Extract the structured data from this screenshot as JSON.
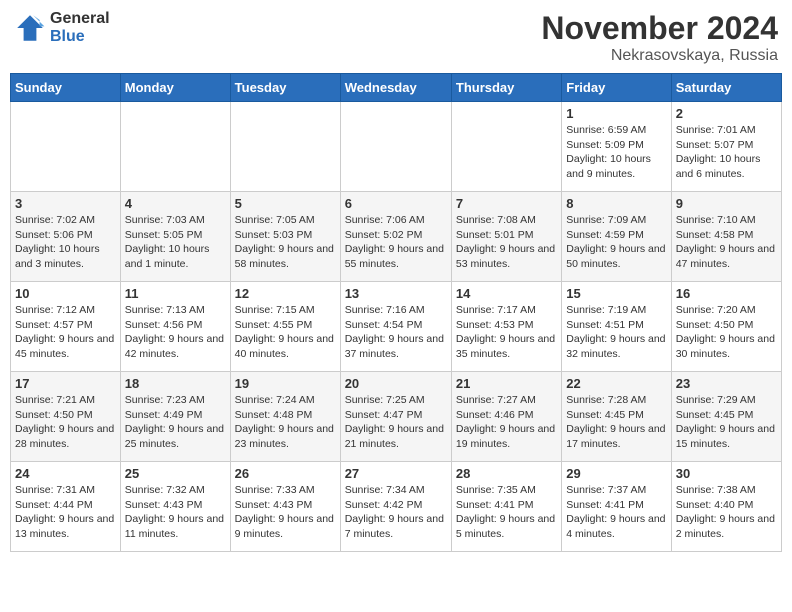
{
  "logo": {
    "general": "General",
    "blue": "Blue"
  },
  "header": {
    "month": "November 2024",
    "location": "Nekrasovskaya, Russia"
  },
  "weekdays": [
    "Sunday",
    "Monday",
    "Tuesday",
    "Wednesday",
    "Thursday",
    "Friday",
    "Saturday"
  ],
  "weeks": [
    [
      {
        "day": "",
        "info": ""
      },
      {
        "day": "",
        "info": ""
      },
      {
        "day": "",
        "info": ""
      },
      {
        "day": "",
        "info": ""
      },
      {
        "day": "",
        "info": ""
      },
      {
        "day": "1",
        "info": "Sunrise: 6:59 AM\nSunset: 5:09 PM\nDaylight: 10 hours and 9 minutes."
      },
      {
        "day": "2",
        "info": "Sunrise: 7:01 AM\nSunset: 5:07 PM\nDaylight: 10 hours and 6 minutes."
      }
    ],
    [
      {
        "day": "3",
        "info": "Sunrise: 7:02 AM\nSunset: 5:06 PM\nDaylight: 10 hours and 3 minutes."
      },
      {
        "day": "4",
        "info": "Sunrise: 7:03 AM\nSunset: 5:05 PM\nDaylight: 10 hours and 1 minute."
      },
      {
        "day": "5",
        "info": "Sunrise: 7:05 AM\nSunset: 5:03 PM\nDaylight: 9 hours and 58 minutes."
      },
      {
        "day": "6",
        "info": "Sunrise: 7:06 AM\nSunset: 5:02 PM\nDaylight: 9 hours and 55 minutes."
      },
      {
        "day": "7",
        "info": "Sunrise: 7:08 AM\nSunset: 5:01 PM\nDaylight: 9 hours and 53 minutes."
      },
      {
        "day": "8",
        "info": "Sunrise: 7:09 AM\nSunset: 4:59 PM\nDaylight: 9 hours and 50 minutes."
      },
      {
        "day": "9",
        "info": "Sunrise: 7:10 AM\nSunset: 4:58 PM\nDaylight: 9 hours and 47 minutes."
      }
    ],
    [
      {
        "day": "10",
        "info": "Sunrise: 7:12 AM\nSunset: 4:57 PM\nDaylight: 9 hours and 45 minutes."
      },
      {
        "day": "11",
        "info": "Sunrise: 7:13 AM\nSunset: 4:56 PM\nDaylight: 9 hours and 42 minutes."
      },
      {
        "day": "12",
        "info": "Sunrise: 7:15 AM\nSunset: 4:55 PM\nDaylight: 9 hours and 40 minutes."
      },
      {
        "day": "13",
        "info": "Sunrise: 7:16 AM\nSunset: 4:54 PM\nDaylight: 9 hours and 37 minutes."
      },
      {
        "day": "14",
        "info": "Sunrise: 7:17 AM\nSunset: 4:53 PM\nDaylight: 9 hours and 35 minutes."
      },
      {
        "day": "15",
        "info": "Sunrise: 7:19 AM\nSunset: 4:51 PM\nDaylight: 9 hours and 32 minutes."
      },
      {
        "day": "16",
        "info": "Sunrise: 7:20 AM\nSunset: 4:50 PM\nDaylight: 9 hours and 30 minutes."
      }
    ],
    [
      {
        "day": "17",
        "info": "Sunrise: 7:21 AM\nSunset: 4:50 PM\nDaylight: 9 hours and 28 minutes."
      },
      {
        "day": "18",
        "info": "Sunrise: 7:23 AM\nSunset: 4:49 PM\nDaylight: 9 hours and 25 minutes."
      },
      {
        "day": "19",
        "info": "Sunrise: 7:24 AM\nSunset: 4:48 PM\nDaylight: 9 hours and 23 minutes."
      },
      {
        "day": "20",
        "info": "Sunrise: 7:25 AM\nSunset: 4:47 PM\nDaylight: 9 hours and 21 minutes."
      },
      {
        "day": "21",
        "info": "Sunrise: 7:27 AM\nSunset: 4:46 PM\nDaylight: 9 hours and 19 minutes."
      },
      {
        "day": "22",
        "info": "Sunrise: 7:28 AM\nSunset: 4:45 PM\nDaylight: 9 hours and 17 minutes."
      },
      {
        "day": "23",
        "info": "Sunrise: 7:29 AM\nSunset: 4:45 PM\nDaylight: 9 hours and 15 minutes."
      }
    ],
    [
      {
        "day": "24",
        "info": "Sunrise: 7:31 AM\nSunset: 4:44 PM\nDaylight: 9 hours and 13 minutes."
      },
      {
        "day": "25",
        "info": "Sunrise: 7:32 AM\nSunset: 4:43 PM\nDaylight: 9 hours and 11 minutes."
      },
      {
        "day": "26",
        "info": "Sunrise: 7:33 AM\nSunset: 4:43 PM\nDaylight: 9 hours and 9 minutes."
      },
      {
        "day": "27",
        "info": "Sunrise: 7:34 AM\nSunset: 4:42 PM\nDaylight: 9 hours and 7 minutes."
      },
      {
        "day": "28",
        "info": "Sunrise: 7:35 AM\nSunset: 4:41 PM\nDaylight: 9 hours and 5 minutes."
      },
      {
        "day": "29",
        "info": "Sunrise: 7:37 AM\nSunset: 4:41 PM\nDaylight: 9 hours and 4 minutes."
      },
      {
        "day": "30",
        "info": "Sunrise: 7:38 AM\nSunset: 4:40 PM\nDaylight: 9 hours and 2 minutes."
      }
    ]
  ]
}
